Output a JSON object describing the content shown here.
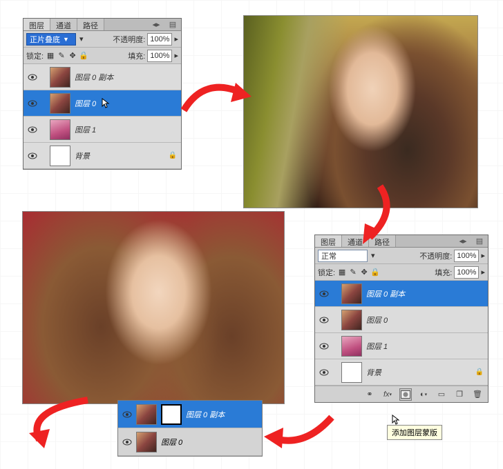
{
  "panel1": {
    "tabs": [
      "图层",
      "通道",
      "路径"
    ],
    "blend_mode": "正片叠底",
    "opacity_label": "不透明度:",
    "opacity_value": "100%",
    "lock_label": "锁定:",
    "fill_label": "填充:",
    "fill_value": "100%",
    "layers": [
      {
        "name": "图层 0 副本",
        "thumb": "img",
        "selected": false,
        "locked": false
      },
      {
        "name": "图层 0",
        "thumb": "img",
        "selected": true,
        "locked": false
      },
      {
        "name": "图层 1",
        "thumb": "pink",
        "selected": false,
        "locked": false
      },
      {
        "name": "背景",
        "thumb": "white",
        "selected": false,
        "locked": true
      }
    ]
  },
  "panel2": {
    "tabs": [
      "图层",
      "通道",
      "路径"
    ],
    "blend_mode": "正常",
    "opacity_label": "不透明度:",
    "opacity_value": "100%",
    "lock_label": "锁定:",
    "fill_label": "填充:",
    "fill_value": "100%",
    "layers": [
      {
        "name": "图层 0 副本",
        "thumb": "img",
        "selected": true,
        "locked": false
      },
      {
        "name": "图层 0",
        "thumb": "img",
        "selected": false,
        "locked": false
      },
      {
        "name": "图层 1",
        "thumb": "pink",
        "selected": false,
        "locked": false
      },
      {
        "name": "背景",
        "thumb": "white",
        "selected": false,
        "locked": true
      }
    ],
    "tooltip": "添加图层蒙版",
    "bottom_buttons": [
      "link-icon",
      "fx-icon",
      "mask-icon",
      "adjustment-icon",
      "group-icon",
      "new-layer-icon",
      "trash-icon"
    ]
  },
  "mini": {
    "layers": [
      {
        "name": "图层 0 副本",
        "thumb": "img",
        "mask": true,
        "selected": true
      },
      {
        "name": "图层 0",
        "thumb": "img",
        "mask": false,
        "selected": false
      }
    ]
  },
  "icons": {
    "menu": "≡",
    "expand": "▸",
    "lock": "🔒",
    "eye": "👁"
  }
}
